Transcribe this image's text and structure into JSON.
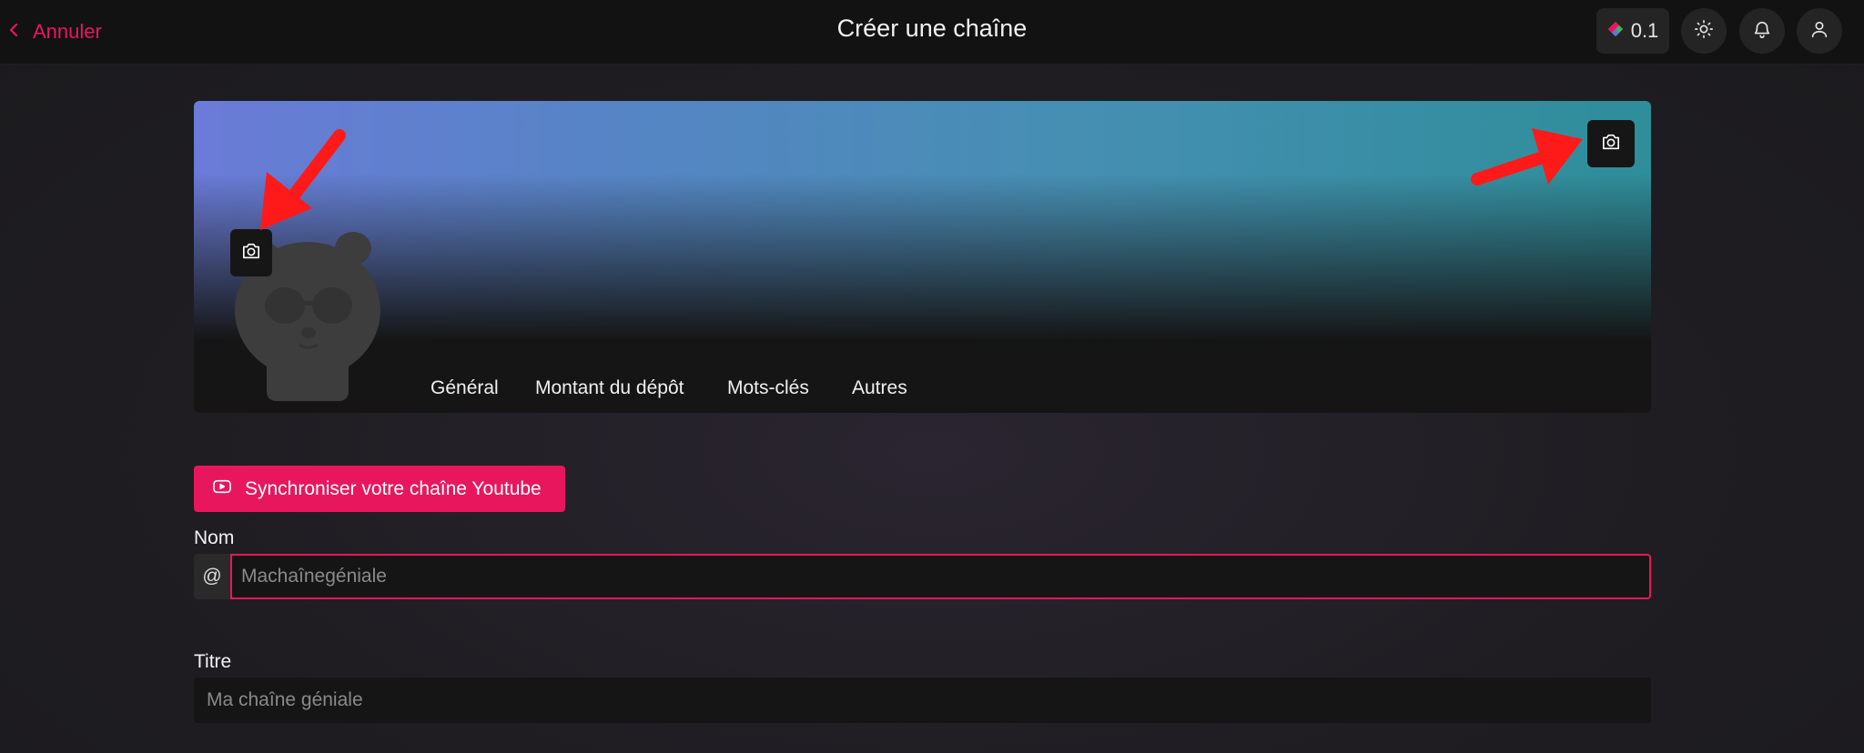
{
  "header": {
    "back_label": "Annuler",
    "title": "Créer une chaîne",
    "credits_value": "0.1"
  },
  "tabs": [
    {
      "label": "Général",
      "active": true
    },
    {
      "label": "Montant du dépôt",
      "active": false
    },
    {
      "label": "Mots-clés",
      "active": false
    },
    {
      "label": "Autres",
      "active": false
    }
  ],
  "sync_button_label": "Synchroniser votre chaîne Youtube",
  "form": {
    "nom_label": "Nom",
    "nom_prefix": "@",
    "nom_placeholder": "Machaînegéniale",
    "titre_label": "Titre",
    "titre_placeholder": "Ma chaîne géniale"
  },
  "colors": {
    "accent": "#e8175d",
    "annotation_arrow": "#ff1a1a"
  },
  "icons": [
    "chevron-left-icon",
    "credits-logo-icon",
    "sun-icon",
    "bell-icon",
    "user-icon",
    "camera-icon",
    "youtube-icon"
  ]
}
